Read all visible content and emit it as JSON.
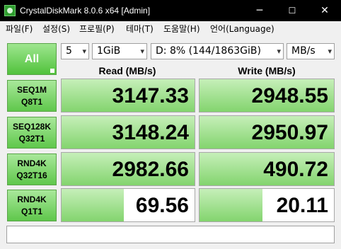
{
  "window": {
    "title": "CrystalDiskMark 8.0.6 x64 [Admin]",
    "minimize": "─",
    "maximize": "☐",
    "close": "✕"
  },
  "menu": [
    "파일(F)",
    "설정(S)",
    "프로필(P)",
    "테마(T)",
    "도움말(H)",
    "언어(Language)"
  ],
  "controls": {
    "all_label": "All",
    "count": "5",
    "size": "1GiB",
    "drive": "D: 8% (144/1863GiB)",
    "unit": "MB/s"
  },
  "headers": {
    "read": "Read (MB/s)",
    "write": "Write (MB/s)"
  },
  "rows": [
    {
      "test_line1": "SEQ1M",
      "test_line2": "Q8T1",
      "read": "3147.33",
      "write": "2948.55",
      "read_fill": 1.0,
      "write_fill": 1.0
    },
    {
      "test_line1": "SEQ128K",
      "test_line2": "Q32T1",
      "read": "3148.24",
      "write": "2950.97",
      "read_fill": 1.0,
      "write_fill": 1.0
    },
    {
      "test_line1": "RND4K",
      "test_line2": "Q32T16",
      "read": "2982.66",
      "write": "490.72",
      "read_fill": 1.0,
      "write_fill": 1.0
    },
    {
      "test_line1": "RND4K",
      "test_line2": "Q1T1",
      "read": "69.56",
      "write": "20.11",
      "read_fill": 0.47,
      "write_fill": 0.47
    }
  ],
  "comment": "",
  "colors": {
    "accent_green": "#51c23c",
    "bar_green": "#83d46e",
    "titlebar": "#000000"
  }
}
